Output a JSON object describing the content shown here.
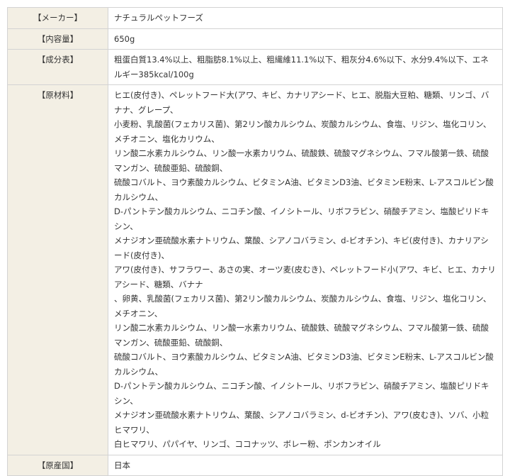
{
  "rows": [
    {
      "label": "【メーカー】",
      "value": "ナチュラルペットフーズ"
    },
    {
      "label": "【内容量】",
      "value": "650g"
    },
    {
      "label": "【成分表】",
      "value": "粗蛋白質13.4%以上、粗脂肪8.1%以上、粗繊維11.1%以下、粗灰分4.6%以下、水分9.4%以下、エネルギー385kcal/100g"
    },
    {
      "label": "【原材料】",
      "lines": [
        "ヒエ(皮付き)、ペレットフード大(アワ、キビ、カナリアシード、ヒエ、脱脂大豆粕、糖類、リンゴ、バナナ、グレープ、",
        "小麦粉、乳酸菌(フェカリス菌)、第2リン酸カルシウム、炭酸カルシウム、食塩、リジン、塩化コリン、メチオニン、塩化カリウム、",
        "リン酸二水素カルシウム、リン酸一水素カリウム、硫酸鉄、硫酸マグネシウム、フマル酸第一鉄、硫酸マンガン、硫酸亜鉛、硫酸銅、",
        "硫酸コバルト、ヨウ素酸カルシウム、ビタミンA油、ビタミンD3油、ビタミンE粉末、L-アスコルビン酸カルシウム、",
        "D-パントテン酸カルシウム、ニコチン酸、イノシトール、リボフラビン、硝酸チアミン、塩酸ピリドキシン、",
        "メナジオン亜硫酸水素ナトリウム、葉酸、シアノコバラミン、d-ビオチン)、キビ(皮付き)、カナリアシード(皮付き)、",
        "アワ(皮付き)、サフラワー、あさの実、オーツ麦(皮むき)、ペレットフード小(アワ、キビ、ヒエ、カナリアシード、糖類、バナナ",
        "、卵黄、乳酸菌(フェカリス菌)、第2リン酸カルシウム、炭酸カルシウム、食塩、リジン、塩化コリン、メチオニン、",
        "リン酸二水素カルシウム、リン酸一水素カリウム、硫酸鉄、硫酸マグネシウム、フマル酸第一鉄、硫酸マンガン、硫酸亜鉛、硫酸銅、",
        "硫酸コバルト、ヨウ素酸カルシウム、ビタミンA油、ビタミンD3油、ビタミンE粉末、L-アスコルビン酸カルシウム、",
        "D-パントテン酸カルシウム、ニコチン酸、イノシトール、リボフラビン、硝酸チアミン、塩酸ピリドキシン、",
        "メナジオン亜硫酸水素ナトリウム、葉酸、シアノコバラミン、d-ビオチン)、アワ(皮むき)、ソバ、小粒ヒマワリ、",
        "白ヒマワリ、パパイヤ、リンゴ、ココナッツ、ボレー粉、ポンカンオイル"
      ]
    },
    {
      "label": "【原産国】",
      "value": "日本"
    }
  ]
}
